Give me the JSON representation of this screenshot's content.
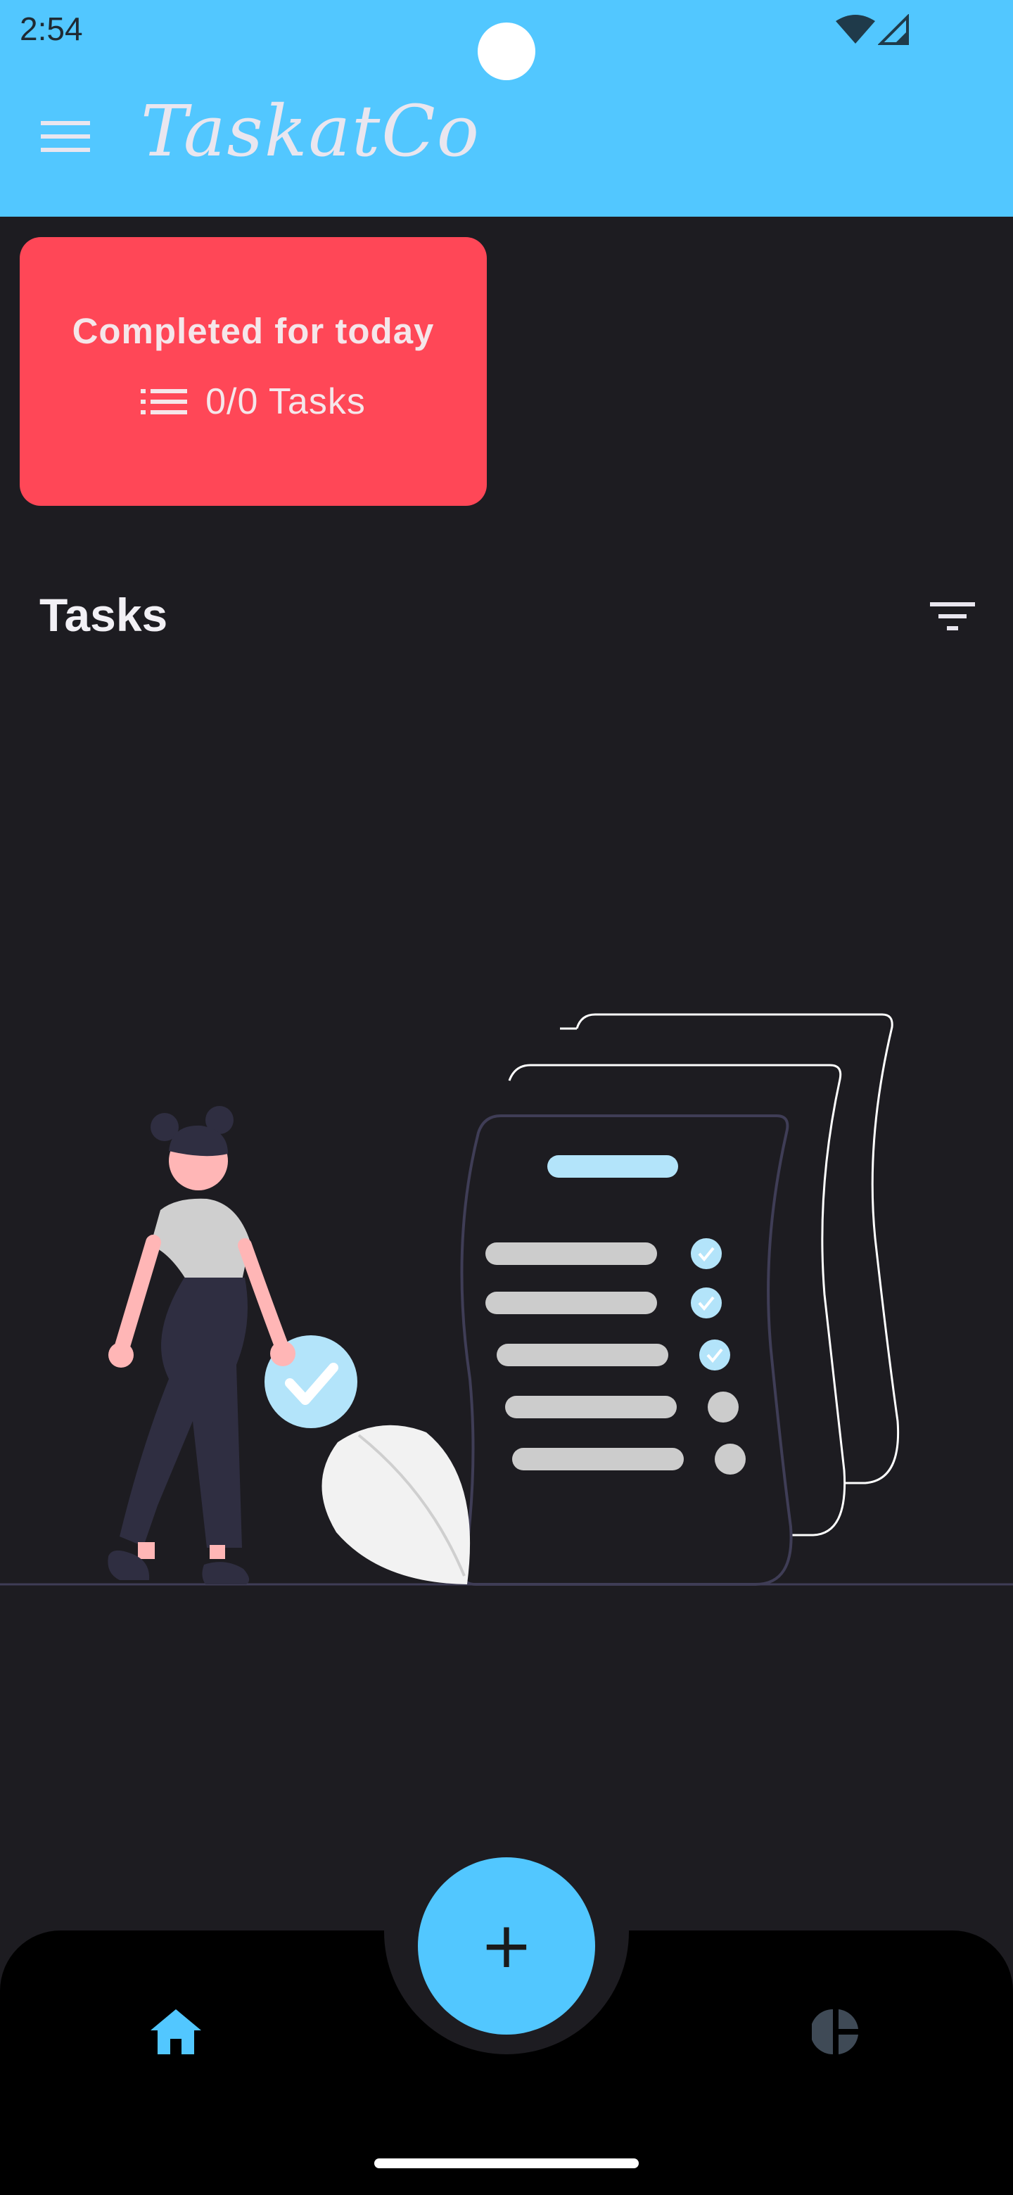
{
  "status_bar": {
    "time": "2:54"
  },
  "app_bar": {
    "title": "TaskatCo",
    "menu_icon": "hamburger-menu-icon"
  },
  "summary_card": {
    "title": "Completed for today",
    "count_text": "0/0 Tasks",
    "icon": "list-icon",
    "color": "#ff4757"
  },
  "tasks_section": {
    "heading": "Tasks",
    "filter_icon": "filter-icon"
  },
  "bottom_nav": {
    "fab_label": "+",
    "home_icon": "home-icon",
    "stats_icon": "pie-chart-icon"
  },
  "colors": {
    "accent": "#52c7ff",
    "background": "#1d1c21",
    "card": "#ff4757"
  }
}
